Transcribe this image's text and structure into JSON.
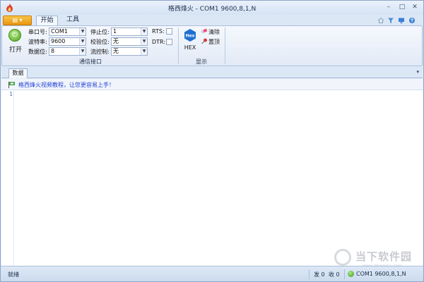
{
  "window": {
    "title": "格西烽火 - COM1  9600,8,1,N"
  },
  "window_controls": {
    "minimize": "–",
    "maximize": "□",
    "close": "✕"
  },
  "app_menu": {
    "label": "▤ ▾"
  },
  "tabs": [
    {
      "label": "开始"
    },
    {
      "label": "工具"
    }
  ],
  "ribbon": {
    "open_label": "打开",
    "comm_group": {
      "label": "通信接口",
      "port_label": "串口号:",
      "port_value": "COM1",
      "baud_label": "波特率:",
      "baud_value": "9600",
      "databits_label": "数据位:",
      "databits_value": "8",
      "stopbits_label": "停止位:",
      "stopbits_value": "1",
      "parity_label": "校验位:",
      "parity_value": "无",
      "flow_label": "流控制:",
      "flow_value": "无",
      "rts_label": "RTS:",
      "dtr_label": "DTR:"
    },
    "display_group": {
      "label": "显示",
      "hex_icon_text": "Hex",
      "hex_label": "HEX",
      "clear_label": "清除",
      "top_label": "置顶"
    }
  },
  "panel": {
    "tab_label": "数据",
    "dropdown": "▾"
  },
  "notice": {
    "text": "格西烽火视频教程，让您更容易上手！"
  },
  "editor": {
    "line_number": "1"
  },
  "status": {
    "ready": "就绪",
    "sent": "发 0",
    "received": "收 0",
    "port_info": "COM1  9600,8,1,N"
  },
  "watermark": {
    "text": "当下软件园",
    "sub": "www.downxia.com"
  }
}
